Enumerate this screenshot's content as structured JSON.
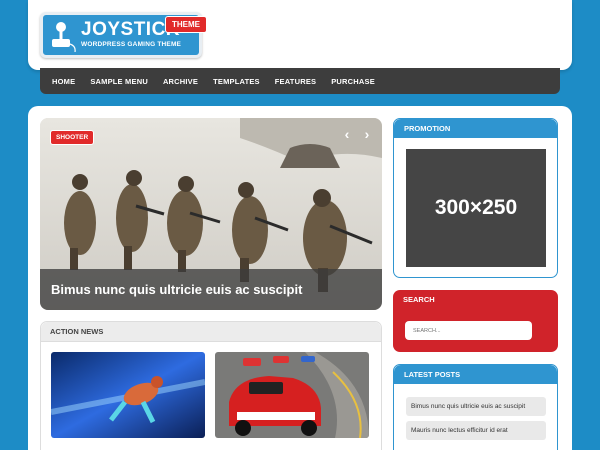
{
  "header": {
    "logo_title": "JOYSTICK",
    "logo_subtitle": "WORDPRESS GAMING THEME",
    "logo_badge": "THEME"
  },
  "nav": {
    "items": [
      "HOME",
      "SAMPLE MENU",
      "ARCHIVE",
      "TEMPLATES",
      "FEATURES",
      "PURCHASE"
    ]
  },
  "slider": {
    "tag": "SHOOTER",
    "caption": "Bimus nunc quis ultricie euis ac suscipit",
    "prev_icon": "chevron-left-icon",
    "next_icon": "chevron-right-icon"
  },
  "action_news": {
    "title": "ACTION NEWS"
  },
  "promotion": {
    "title": "PROMOTION",
    "ad_text": "300×250"
  },
  "search": {
    "title": "SEARCH",
    "placeholder": "SEARCH..."
  },
  "latest_posts": {
    "title": "LATEST POSTS",
    "items": [
      "Bimus nunc quis ultricie euis ac suscipit",
      "Mauris nunc lectus efficitur id erat"
    ]
  },
  "colors": {
    "background": "#1d8cc6",
    "accent_blue": "#2f95d0",
    "accent_red": "#d0232a",
    "nav_dark": "#3d3d3d"
  }
}
